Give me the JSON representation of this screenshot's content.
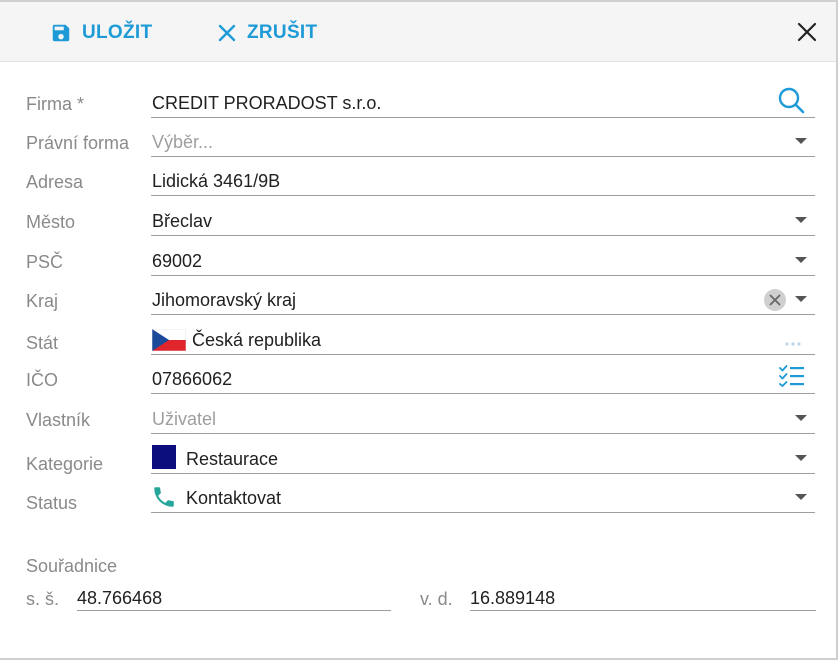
{
  "toolbar": {
    "save_label": "ULOŽIT",
    "cancel_label": "ZRUŠIT",
    "accent_color": "#1e9bd7"
  },
  "form": {
    "firma": {
      "label": "Firma *",
      "value": "CREDIT PRORADOST  s.r.o."
    },
    "pravni_forma": {
      "label": "Právní forma",
      "placeholder": "Výběr..."
    },
    "adresa": {
      "label": "Adresa",
      "value": "Lidická 3461/9B"
    },
    "mesto": {
      "label": "Město",
      "value": "Břeclav"
    },
    "psc": {
      "label": "PSČ",
      "value": "69002"
    },
    "kraj": {
      "label": "Kraj",
      "value": "Jihomoravský kraj"
    },
    "stat": {
      "label": "Stát",
      "value": "Česká republika",
      "flag": "czech-flag"
    },
    "ico": {
      "label": "IČO",
      "value": "07866062"
    },
    "vlastnik": {
      "label": "Vlastník",
      "placeholder": "Uživatel"
    },
    "kategorie": {
      "label": "Kategorie",
      "value": "Restaurace",
      "color": "#0d0e7e"
    },
    "status": {
      "label": "Status",
      "value": "Kontaktovat",
      "icon": "phone-icon",
      "icon_color": "#26a69a"
    }
  },
  "coordinates": {
    "heading": "Souřadnice",
    "lat_label": "s. š.",
    "lat_value": "48.766468",
    "lon_label": "v. d.",
    "lon_value": "16.889148"
  }
}
